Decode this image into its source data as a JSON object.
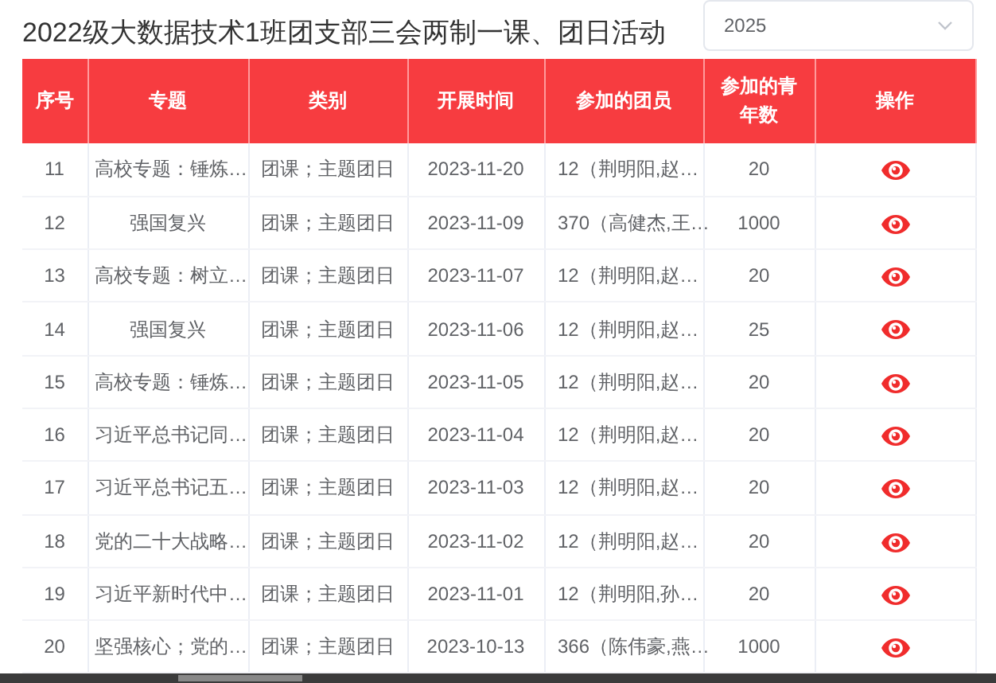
{
  "title": "2022级大数据技术1班团支部三会两制一课、团日活动",
  "year_select": {
    "value": "2025"
  },
  "table": {
    "columns": [
      "序号",
      "专题",
      "类别",
      "开展时间",
      "参加的团员",
      "参加的青年数",
      "操作"
    ],
    "rows": [
      {
        "cells": [
          "11",
          "高校专题：锤炼…",
          "团课；主题团日",
          "2023-11-20",
          "12（荆明阳,赵…",
          "20"
        ]
      },
      {
        "cells": [
          "12",
          "强国复兴",
          "团课；主题团日",
          "2023-11-09",
          "370（高健杰,王…",
          "1000"
        ]
      },
      {
        "cells": [
          "13",
          "高校专题：树立…",
          "团课；主题团日",
          "2023-11-07",
          "12（荆明阳,赵…",
          "20"
        ]
      },
      {
        "cells": [
          "14",
          "强国复兴",
          "团课；主题团日",
          "2023-11-06",
          "12（荆明阳,赵…",
          "25"
        ]
      },
      {
        "cells": [
          "15",
          "高校专题：锤炼…",
          "团课；主题团日",
          "2023-11-05",
          "12（荆明阳,赵…",
          "20"
        ]
      },
      {
        "cells": [
          "16",
          "习近平总书记同…",
          "团课；主题团日",
          "2023-11-04",
          "12（荆明阳,赵…",
          "20"
        ]
      },
      {
        "cells": [
          "17",
          "习近平总书记五…",
          "团课；主题团日",
          "2023-11-03",
          "12（荆明阳,赵…",
          "20"
        ]
      },
      {
        "cells": [
          "18",
          "党的二十大战略…",
          "团课；主题团日",
          "2023-11-02",
          "12（荆明阳,赵…",
          "20"
        ]
      },
      {
        "cells": [
          "19",
          "习近平新时代中…",
          "团课；主题团日",
          "2023-11-01",
          "12（荆明阳,孙…",
          "20"
        ]
      },
      {
        "cells": [
          "20",
          "坚强核心；党的…",
          "团课；主题团日",
          "2023-10-13",
          "366（陈伟豪,燕…",
          "1000"
        ]
      }
    ]
  }
}
